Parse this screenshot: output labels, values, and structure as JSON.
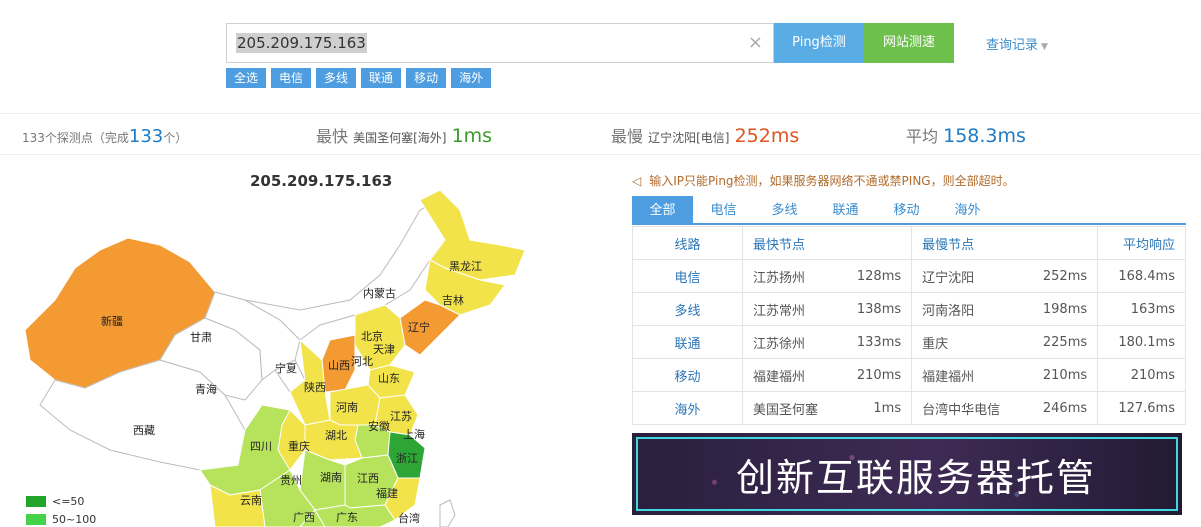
{
  "search": {
    "value": "205.209.175.163",
    "clear_glyph": "×",
    "ping_label": "Ping检测",
    "speed_label": "网站测速",
    "history_label": "查询记录"
  },
  "filters": [
    "全选",
    "电信",
    "多线",
    "联通",
    "移动",
    "海外"
  ],
  "stats": {
    "count_prefix": "133个探测点（完成",
    "count_done": "133",
    "count_suffix": "个）",
    "fastest_label": "最快",
    "fastest_loc": "美国圣何塞[海外]",
    "fastest_val": "1ms",
    "slowest_label": "最慢",
    "slowest_loc": "辽宁沈阳[电信]",
    "slowest_val": "252ms",
    "avg_label": "平均",
    "avg_val": "158.3ms"
  },
  "map": {
    "title": "205.209.175.163",
    "provinces": [
      "新疆",
      "甘肃",
      "青海",
      "西藏",
      "内蒙古",
      "黑龙江",
      "吉林",
      "辽宁",
      "北京",
      "天津",
      "河北",
      "山西",
      "山东",
      "宁夏",
      "陕西",
      "河南",
      "江苏",
      "安徽",
      "上海",
      "湖北",
      "四川",
      "重庆",
      "浙江",
      "湖南",
      "江西",
      "贵州",
      "云南",
      "福建",
      "广西",
      "广东",
      "台湾"
    ],
    "legend": [
      {
        "label": "<=50",
        "color": "#22a52a"
      },
      {
        "label": "50~100",
        "color": "#44d24a"
      }
    ],
    "colors": {
      "orange": "#f39a33",
      "yellow": "#f2e34a",
      "lightgreen": "#b7e25b",
      "green": "#2ea636",
      "white": "#ffffff"
    }
  },
  "notice": "输入IP只能Ping检测，如果服务器网络不通或禁PING，则全部超时。",
  "tabs": [
    "全部",
    "电信",
    "多线",
    "联通",
    "移动",
    "海外"
  ],
  "table": {
    "headers": [
      "线路",
      "最快节点",
      "最慢节点",
      "平均响应"
    ],
    "rows": [
      {
        "line": "电信",
        "fast_node": "江苏扬州",
        "fast_ms": "128ms",
        "slow_node": "辽宁沈阳",
        "slow_ms": "252ms",
        "avg": "168.4ms"
      },
      {
        "line": "多线",
        "fast_node": "江苏常州",
        "fast_ms": "138ms",
        "slow_node": "河南洛阳",
        "slow_ms": "198ms",
        "avg": "163ms"
      },
      {
        "line": "联通",
        "fast_node": "江苏徐州",
        "fast_ms": "133ms",
        "slow_node": "重庆",
        "slow_ms": "225ms",
        "avg": "180.1ms"
      },
      {
        "line": "移动",
        "fast_node": "福建福州",
        "fast_ms": "210ms",
        "slow_node": "福建福州",
        "slow_ms": "210ms",
        "avg": "210ms"
      },
      {
        "line": "海外",
        "fast_node": "美国圣何塞",
        "fast_ms": "1ms",
        "slow_node": "台湾中华电信",
        "slow_ms": "246ms",
        "avg": "127.6ms"
      }
    ]
  },
  "banner": {
    "text": "创新互联服务器托管"
  }
}
